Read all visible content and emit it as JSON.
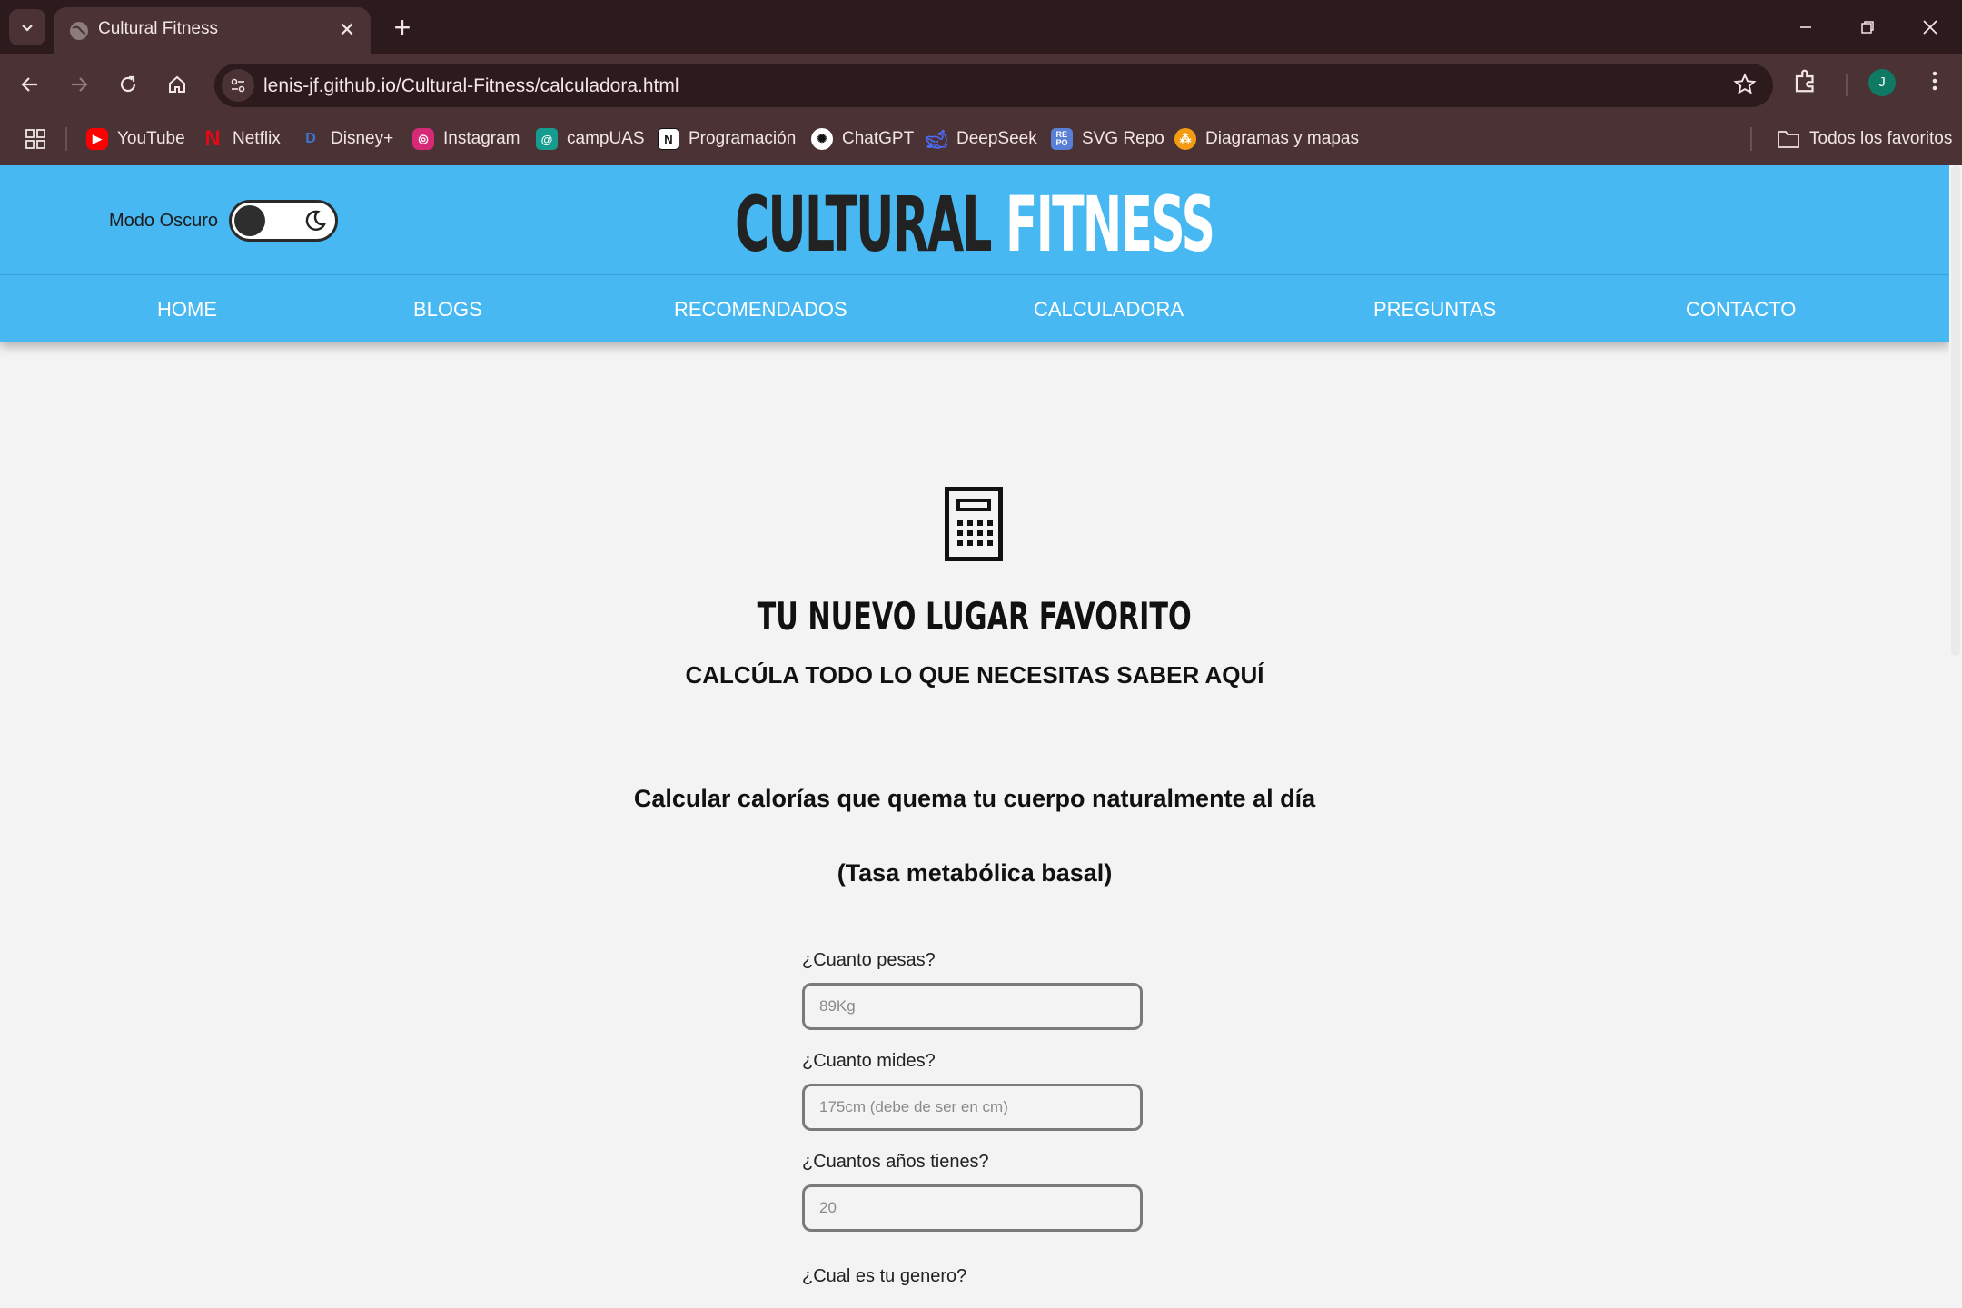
{
  "browser": {
    "tab_title": "Cultural Fitness",
    "url": "lenis-jf.github.io/Cultural-Fitness/calculadora.html",
    "profile_initial": "J",
    "bookmarks": [
      {
        "label": "YouTube"
      },
      {
        "label": "Netflix"
      },
      {
        "label": "Disney+"
      },
      {
        "label": "Instagram"
      },
      {
        "label": "campUAS"
      },
      {
        "label": "Programación"
      },
      {
        "label": "ChatGPT"
      },
      {
        "label": "DeepSeek"
      },
      {
        "label": "SVG Repo"
      },
      {
        "label": "Diagramas y mapas"
      }
    ],
    "all_bookmarks": "Todos los favoritos"
  },
  "header": {
    "dark_mode_label": "Modo Oscuro",
    "brand_word1": "CULTURAL",
    "brand_word2": "FITNESS",
    "nav": [
      "HOME",
      "BLOGS",
      "RECOMENDADOS",
      "CALCULADORA",
      "PREGUNTAS",
      "CONTACTO"
    ]
  },
  "hero": {
    "title": "TU NUEVO LUGAR FAVORITO",
    "subtitle": "CALCÚLA TODO LO QUE NECESITAS SABER AQUÍ"
  },
  "calculator": {
    "title": "Calcular calorías que quema tu cuerpo naturalmente al día",
    "note": "(Tasa metabólica basal)",
    "fields": [
      {
        "label": "¿Cuanto pesas?",
        "placeholder": "89Kg"
      },
      {
        "label": "¿Cuanto mides?",
        "placeholder": "175cm (debe de ser en cm)"
      },
      {
        "label": "¿Cuantos años tienes?",
        "placeholder": "20"
      }
    ],
    "gender_label": "¿Cual es tu genero?"
  },
  "colors": {
    "header_bg": "#47b8f1",
    "chrome_dark": "#2d1a1c",
    "chrome_mid": "#4a3235"
  }
}
